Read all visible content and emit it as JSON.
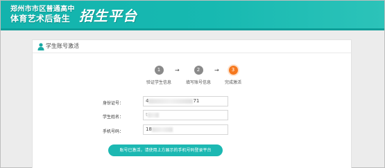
{
  "brand": {
    "line1": "郑州市市区普通高中",
    "line2": "体育艺术后备生",
    "platform": "招生平台"
  },
  "panel": {
    "title": "学生账号激活",
    "icon": "user-icon"
  },
  "steps": [
    {
      "number": "1",
      "label": "验证学生信息",
      "state": "done"
    },
    {
      "number": "2",
      "label": "填写账号信息",
      "state": "done"
    },
    {
      "number": "3",
      "label": "完成激活",
      "state": "active"
    }
  ],
  "step_arrow": "→",
  "form": {
    "id_label": "身份证号：",
    "id_value_prefix": "4",
    "id_value_suffix": "71",
    "name_label": "学生姓名：",
    "name_value_prefix": "t",
    "phone_label": "手机号码：",
    "phone_value_prefix": "18"
  },
  "submit_label": "账号已激活，请使用上方展示的手机号码登录平台",
  "colors": {
    "header": "#17b9b1",
    "active_step": "#f6791f",
    "inactive_step": "#8a8a8a",
    "button": "#1cb8b2"
  }
}
